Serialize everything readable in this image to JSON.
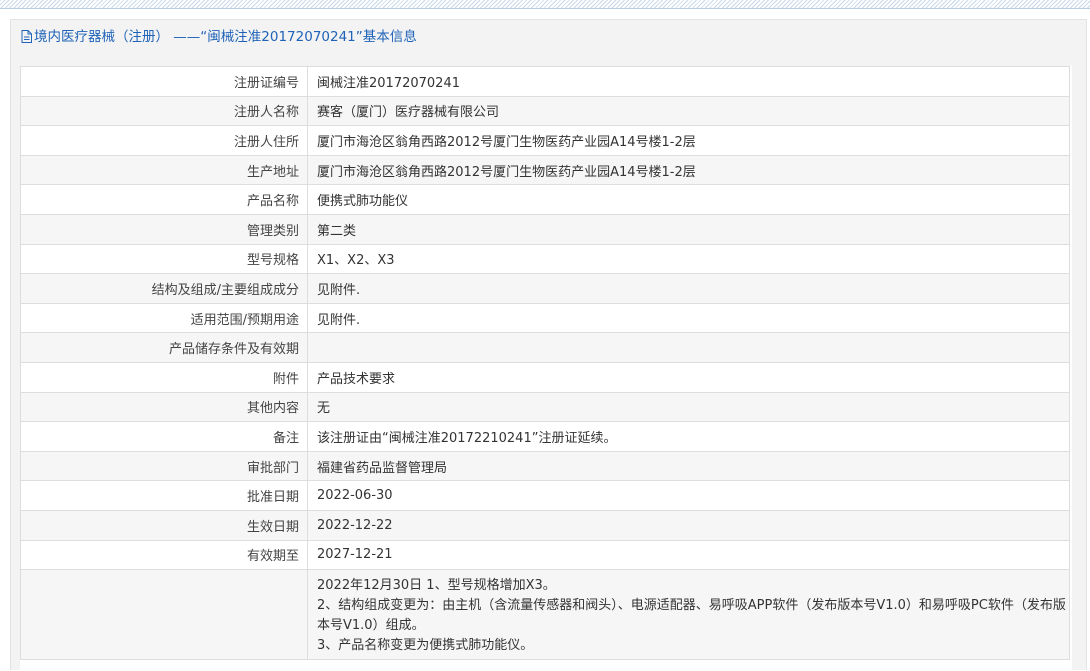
{
  "header": {
    "title": "境内医疗器械（注册） ——“闽械注准20172070241”基本信息"
  },
  "rows": [
    {
      "label": "注册证编号",
      "value": "闽械注准20172070241"
    },
    {
      "label": "注册人名称",
      "value": "赛客（厦门）医疗器械有限公司"
    },
    {
      "label": "注册人住所",
      "value": "厦门市海沧区翁角西路2012号厦门生物医药产业园A14号楼1-2层"
    },
    {
      "label": "生产地址",
      "value": "厦门市海沧区翁角西路2012号厦门生物医药产业园A14号楼1-2层"
    },
    {
      "label": "产品名称",
      "value": "便携式肺功能仪"
    },
    {
      "label": "管理类别",
      "value": "第二类"
    },
    {
      "label": "型号规格",
      "value": "X1、X2、X3"
    },
    {
      "label": "结构及组成/主要组成成分",
      "value": "见附件."
    },
    {
      "label": "适用范围/预期用途",
      "value": "见附件."
    },
    {
      "label": "产品储存条件及有效期",
      "value": ""
    },
    {
      "label": "附件",
      "value": "产品技术要求"
    },
    {
      "label": "其他内容",
      "value": "无"
    },
    {
      "label": "备注",
      "value": "该注册证由“闽械注准20172210241”注册证延续。"
    },
    {
      "label": "审批部门",
      "value": "福建省药品监督管理局"
    },
    {
      "label": "批准日期",
      "value": "2022-06-30"
    },
    {
      "label": "生效日期",
      "value": "2022-12-22"
    },
    {
      "label": "有效期至",
      "value": "2027-12-21"
    }
  ],
  "change_notes": {
    "label": "",
    "lines": [
      "2022年12月30日 1、型号规格增加X3。",
      "2、结构组成变更为：由主机（含流量传感器和阀头）、电源适配器、易呼吸APP软件（发布版本号V1.0）和易呼吸PC软件（发布版本号V1.0）组成。",
      "3、产品名称变更为便携式肺功能仪。"
    ]
  }
}
